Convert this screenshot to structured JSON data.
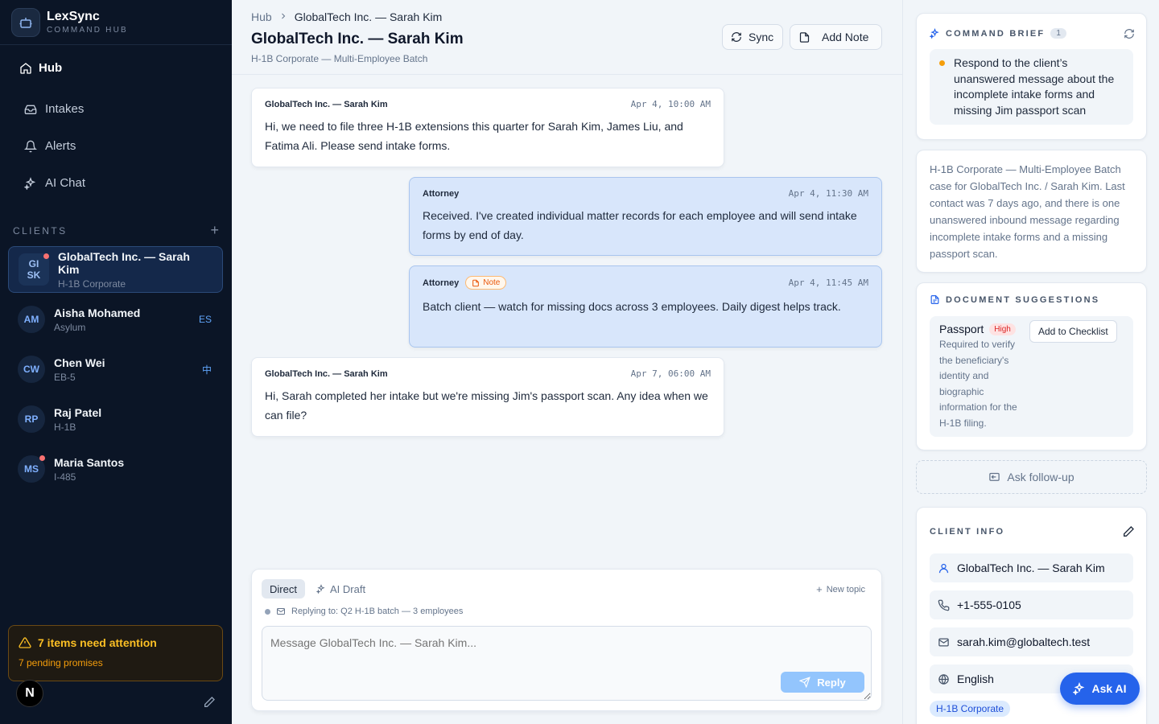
{
  "app": {
    "name": "LexSync",
    "subtitle": "COMMAND HUB"
  },
  "nav": {
    "hub": "Hub",
    "items": [
      {
        "label": "Intakes",
        "icon": "inbox-icon"
      },
      {
        "label": "Alerts",
        "icon": "bell-icon"
      },
      {
        "label": "AI Chat",
        "icon": "sparkles-icon"
      }
    ]
  },
  "clients": {
    "heading": "CLIENTS",
    "list": [
      {
        "initials_top": "GI",
        "initials_bottom": "SK",
        "name": "GlobalTech Inc. — Sarah Kim",
        "type": "H-1B Corporate",
        "lang": "",
        "unread": true
      },
      {
        "initials": "AM",
        "name": "Aisha Mohamed",
        "type": "Asylum",
        "lang": "ES",
        "unread": false
      },
      {
        "initials": "CW",
        "name": "Chen Wei",
        "type": "EB-5",
        "lang": "中",
        "unread": false
      },
      {
        "initials": "RP",
        "name": "Raj Patel",
        "type": "H-1B",
        "lang": "",
        "unread": false
      },
      {
        "initials": "MS",
        "name": "Maria Santos",
        "type": "I-485",
        "lang": "",
        "unread": true
      }
    ]
  },
  "attention": {
    "title": "7 items need attention",
    "sub": "7 pending promises"
  },
  "footer": {
    "avatar": "N"
  },
  "header": {
    "breadcrumb_root": "Hub",
    "breadcrumb_current": "GlobalTech Inc. — Sarah Kim",
    "title": "GlobalTech Inc. — Sarah Kim",
    "subtitle": "H-1B Corporate — Multi-Employee Batch",
    "sync_label": "Sync",
    "add_note_label": "Add Note"
  },
  "messages": [
    {
      "sender": "GlobalTech Inc. — Sarah Kim",
      "time": "Apr 4, 10:00 AM",
      "body": "Hi, we need to file three H-1B extensions this quarter for Sarah Kim, James Liu, and Fatima Ali. Please send intake forms."
    },
    {
      "sender": "Attorney",
      "time": "Apr 4, 11:30 AM",
      "body": "Received. I've created individual matter records for each employee and will send intake forms by end of day."
    },
    {
      "sender": "Attorney",
      "badge": "Note",
      "time": "Apr 4, 11:45 AM",
      "body": "Batch client — watch for missing docs across 3 employees. Daily digest helps track."
    },
    {
      "sender": "GlobalTech Inc. — Sarah Kim",
      "time": "Apr 7, 06:00 AM",
      "body": "Hi, Sarah completed her intake but we're missing Jim's passport scan. Any idea when we can file?"
    }
  ],
  "composer": {
    "mode_direct": "Direct",
    "mode_ai": "AI Draft",
    "new_topic": "New topic",
    "replying_to": "Replying to: Q2 H-1B batch — 3 employees",
    "placeholder": "Message GlobalTech Inc. — Sarah Kim...",
    "reply_label": "Reply"
  },
  "brief": {
    "heading": "COMMAND BRIEF",
    "count": "1",
    "item": "Respond to the client’s unanswered message about the incomplete intake forms and missing Jim passport scan",
    "summary": "H-1B Corporate — Multi-Employee Batch case for GlobalTech Inc. / Sarah Kim. Last contact was 7 days ago, and there is one unanswered inbound message regarding incomplete intake forms and a missing passport scan."
  },
  "documents": {
    "heading": "DOCUMENT SUGGESTIONS",
    "title": "Passport",
    "priority": "High",
    "description": "Required to verify the beneficiary's identity and biographic information for the H-1B filing.",
    "action": "Add to Checklist"
  },
  "followup": "Ask follow-up",
  "client_info": {
    "heading": "CLIENT INFO",
    "name": "GlobalTech Inc. — Sarah Kim",
    "phone": "+1-555-0105",
    "email": "sarah.kim@globaltech.test",
    "language": "English",
    "tag": "H-1B Corporate"
  },
  "ask_ai": "Ask AI",
  "colors": {
    "sidebar_bg": "#0b1526",
    "accent": "#2563eb",
    "warning": "#fbbf24",
    "attorney_bubble": "#d8e6fb"
  }
}
